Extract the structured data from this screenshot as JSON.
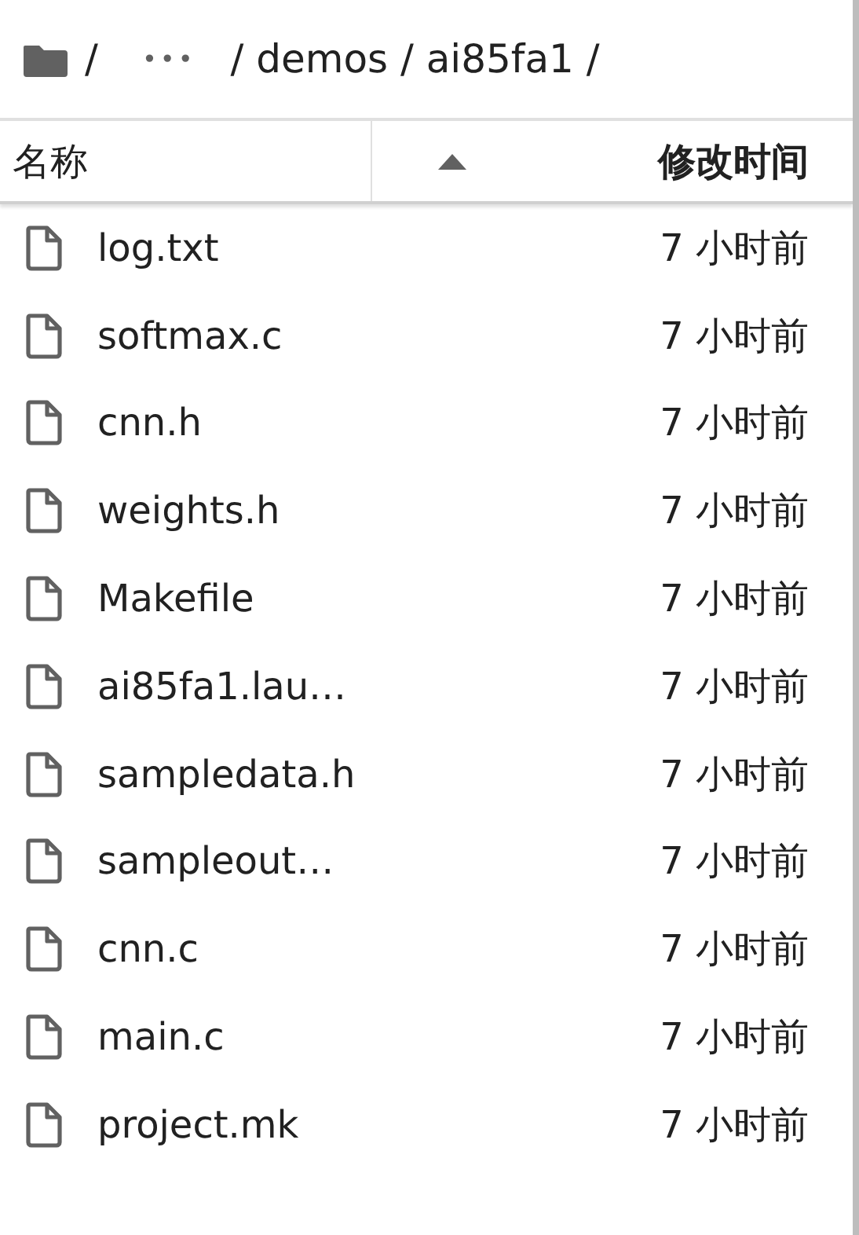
{
  "breadcrumb": {
    "segments": [
      "/",
      "•••",
      "/ demos / ai85fa1 /"
    ]
  },
  "columns": [
    {
      "label": "名称",
      "sorted": false
    },
    {
      "label": "修改时间",
      "sorted": true
    }
  ],
  "rows": [
    {
      "name": "log.txt",
      "modified": "7 小时前"
    },
    {
      "name": "softmax.c",
      "modified": "7 小时前"
    },
    {
      "name": "cnn.h",
      "modified": "7 小时前"
    },
    {
      "name": "weights.h",
      "modified": "7 小时前"
    },
    {
      "name": "Makefile",
      "modified": "7 小时前"
    },
    {
      "name": "ai85fa1.lau…",
      "modified": "7 小时前"
    },
    {
      "name": "sampledata.h",
      "modified": "7 小时前"
    },
    {
      "name": "sampleout…",
      "modified": "7 小时前"
    },
    {
      "name": "cnn.c",
      "modified": "7 小时前"
    },
    {
      "name": "main.c",
      "modified": "7 小时前"
    },
    {
      "name": "project.mk",
      "modified": "7 小时前"
    }
  ]
}
